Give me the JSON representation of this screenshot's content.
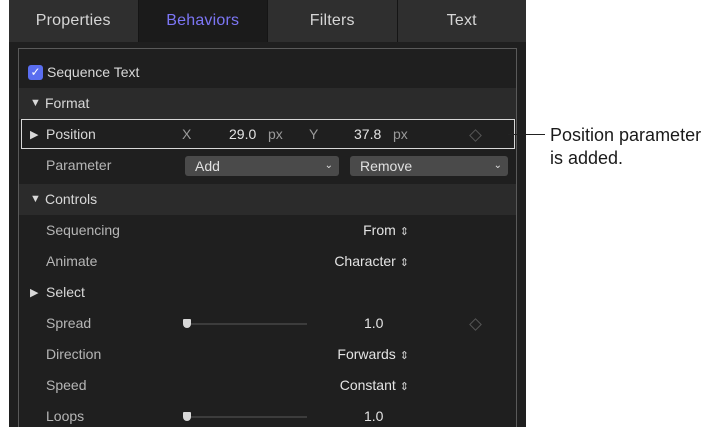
{
  "tabs": [
    "Properties",
    "Behaviors",
    "Filters",
    "Text"
  ],
  "active_tab": "Behaviors",
  "behavior": {
    "name": "Sequence Text",
    "enabled": true
  },
  "format": {
    "label": "Format"
  },
  "position": {
    "label": "Position",
    "x_label": "X",
    "x_value": "29.0",
    "x_unit": "px",
    "y_label": "Y",
    "y_value": "37.8",
    "y_unit": "px"
  },
  "parameter": {
    "label": "Parameter",
    "add": "Add",
    "remove": "Remove"
  },
  "controls": {
    "label": "Controls"
  },
  "sequencing": {
    "label": "Sequencing",
    "value": "From"
  },
  "animate": {
    "label": "Animate",
    "value": "Character"
  },
  "select": {
    "label": "Select"
  },
  "spread": {
    "label": "Spread",
    "value": "1.0"
  },
  "direction": {
    "label": "Direction",
    "value": "Forwards"
  },
  "speed": {
    "label": "Speed",
    "value": "Constant"
  },
  "loops": {
    "label": "Loops",
    "value": "1.0"
  },
  "callout": {
    "line1": "Position parameter",
    "line2": "is added."
  },
  "icons": {
    "checkbox": "checkmark-icon",
    "disclosure_open": "triangle-down-icon",
    "disclosure_closed": "triangle-right-icon",
    "stepper": "up-down-arrows-icon",
    "keyframe": "diamond-icon",
    "popup": "chevron-down-icon"
  },
  "colors": {
    "accent": "#7c76f5",
    "checkbox": "#5a6ef0",
    "panel": "#1f1f1f"
  }
}
